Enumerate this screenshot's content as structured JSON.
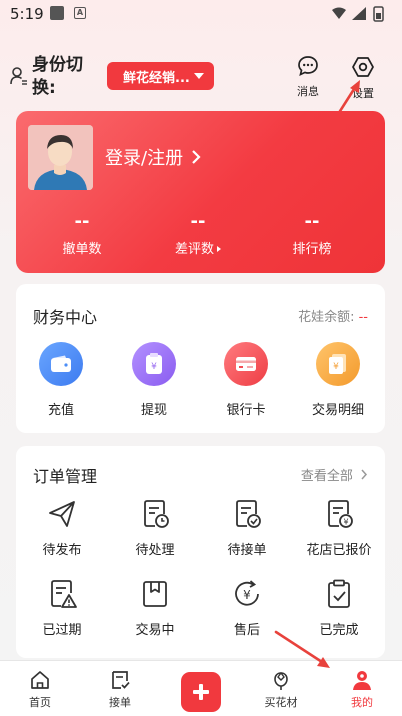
{
  "status_bar": {
    "time": "5:19",
    "notif_icons": [
      "app-icon",
      "a-icon"
    ],
    "right_icons": [
      "wifi-icon",
      "signal-icon",
      "battery-icon"
    ]
  },
  "header": {
    "role_label": "身份切换:",
    "role_select_value": "鲜花经销...",
    "message_label": "消息",
    "settings_label": "设置"
  },
  "profile": {
    "login_label": "登录/注册",
    "stats": [
      {
        "value": "--",
        "label": "撤单数"
      },
      {
        "value": "--",
        "label": "差评数"
      },
      {
        "value": "--",
        "label": "排行榜"
      }
    ]
  },
  "finance": {
    "title": "财务中心",
    "balance_label": "花娃余额:",
    "balance_value": "--",
    "items": [
      {
        "label": "充值",
        "icon": "wallet-icon",
        "color": "#4b8ef7"
      },
      {
        "label": "提现",
        "icon": "yuan-card-icon",
        "color": "#9a6ef0"
      },
      {
        "label": "银行卡",
        "icon": "bank-card-icon",
        "color": "#f24f56"
      },
      {
        "label": "交易明细",
        "icon": "receipt-icon",
        "color": "#f5a23c"
      }
    ]
  },
  "orders": {
    "title": "订单管理",
    "view_all": "查看全部",
    "items": [
      {
        "label": "待发布",
        "icon": "send-icon"
      },
      {
        "label": "待处理",
        "icon": "pending-doc-icon"
      },
      {
        "label": "待接单",
        "icon": "accept-doc-icon"
      },
      {
        "label": "花店已报价",
        "icon": "quoted-doc-icon"
      },
      {
        "label": "已过期",
        "icon": "expired-doc-icon"
      },
      {
        "label": "交易中",
        "icon": "box-icon"
      },
      {
        "label": "售后",
        "icon": "refund-icon"
      },
      {
        "label": "已完成",
        "icon": "clipboard-check-icon"
      }
    ]
  },
  "tab_bar": {
    "items": [
      {
        "label": "首页",
        "icon": "home-icon"
      },
      {
        "label": "接单",
        "icon": "take-order-icon"
      },
      {
        "label": "",
        "icon": "plus-icon"
      },
      {
        "label": "买花材",
        "icon": "flower-icon"
      },
      {
        "label": "我的",
        "icon": "profile-icon",
        "active": true
      }
    ],
    "active_color": "#f1393e"
  },
  "colors": {
    "accent": "#f1393e",
    "arrow": "#e8423c"
  }
}
